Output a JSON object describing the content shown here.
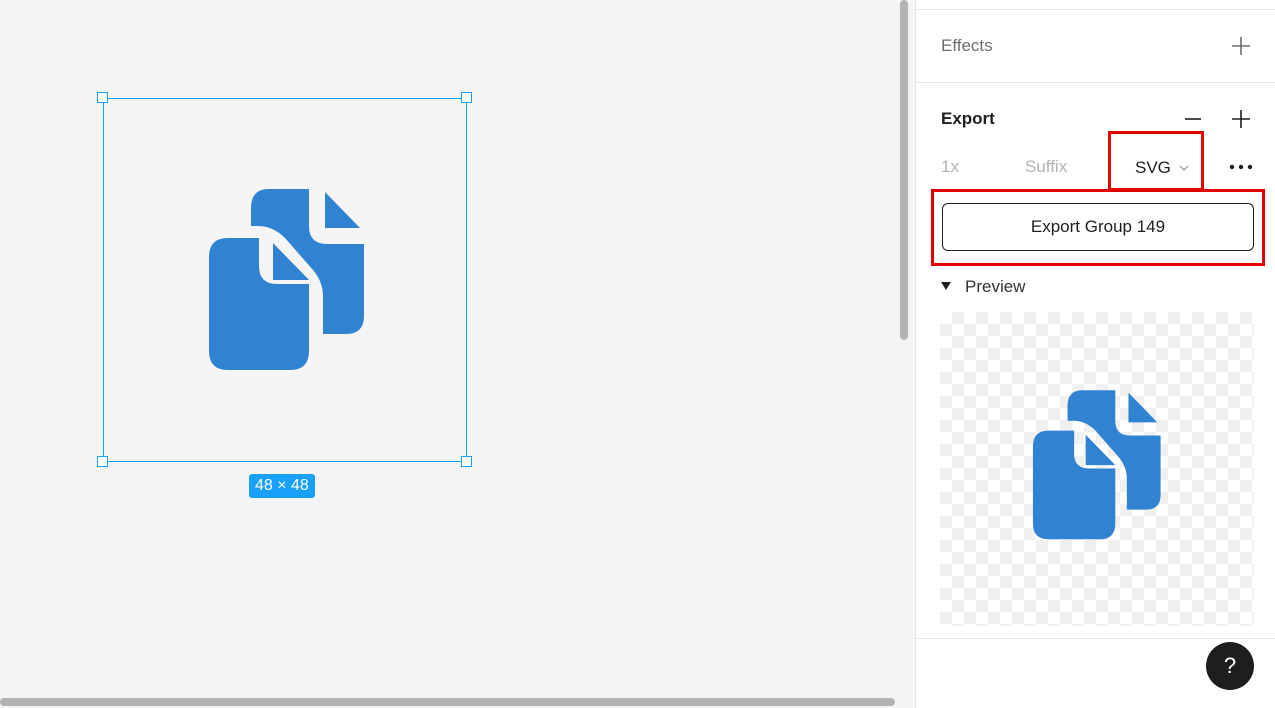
{
  "canvas": {
    "size_badge": "48 × 48",
    "icon": "copy-document-icon",
    "accent_color": "#18a0fb",
    "icon_color": "#3182d0"
  },
  "panel": {
    "effects": {
      "label": "Effects",
      "add_icon": "plus-icon"
    },
    "export": {
      "label": "Export",
      "remove_icon": "minus-icon",
      "add_icon": "plus-icon",
      "scale": "1x",
      "suffix_placeholder": "Suffix",
      "format": "SVG",
      "more_icon": "more-horizontal-icon",
      "export_button": "Export Group 149",
      "highlight_color": "#e00000"
    },
    "preview": {
      "label": "Preview",
      "icon": "copy-document-icon"
    },
    "help": "?"
  }
}
